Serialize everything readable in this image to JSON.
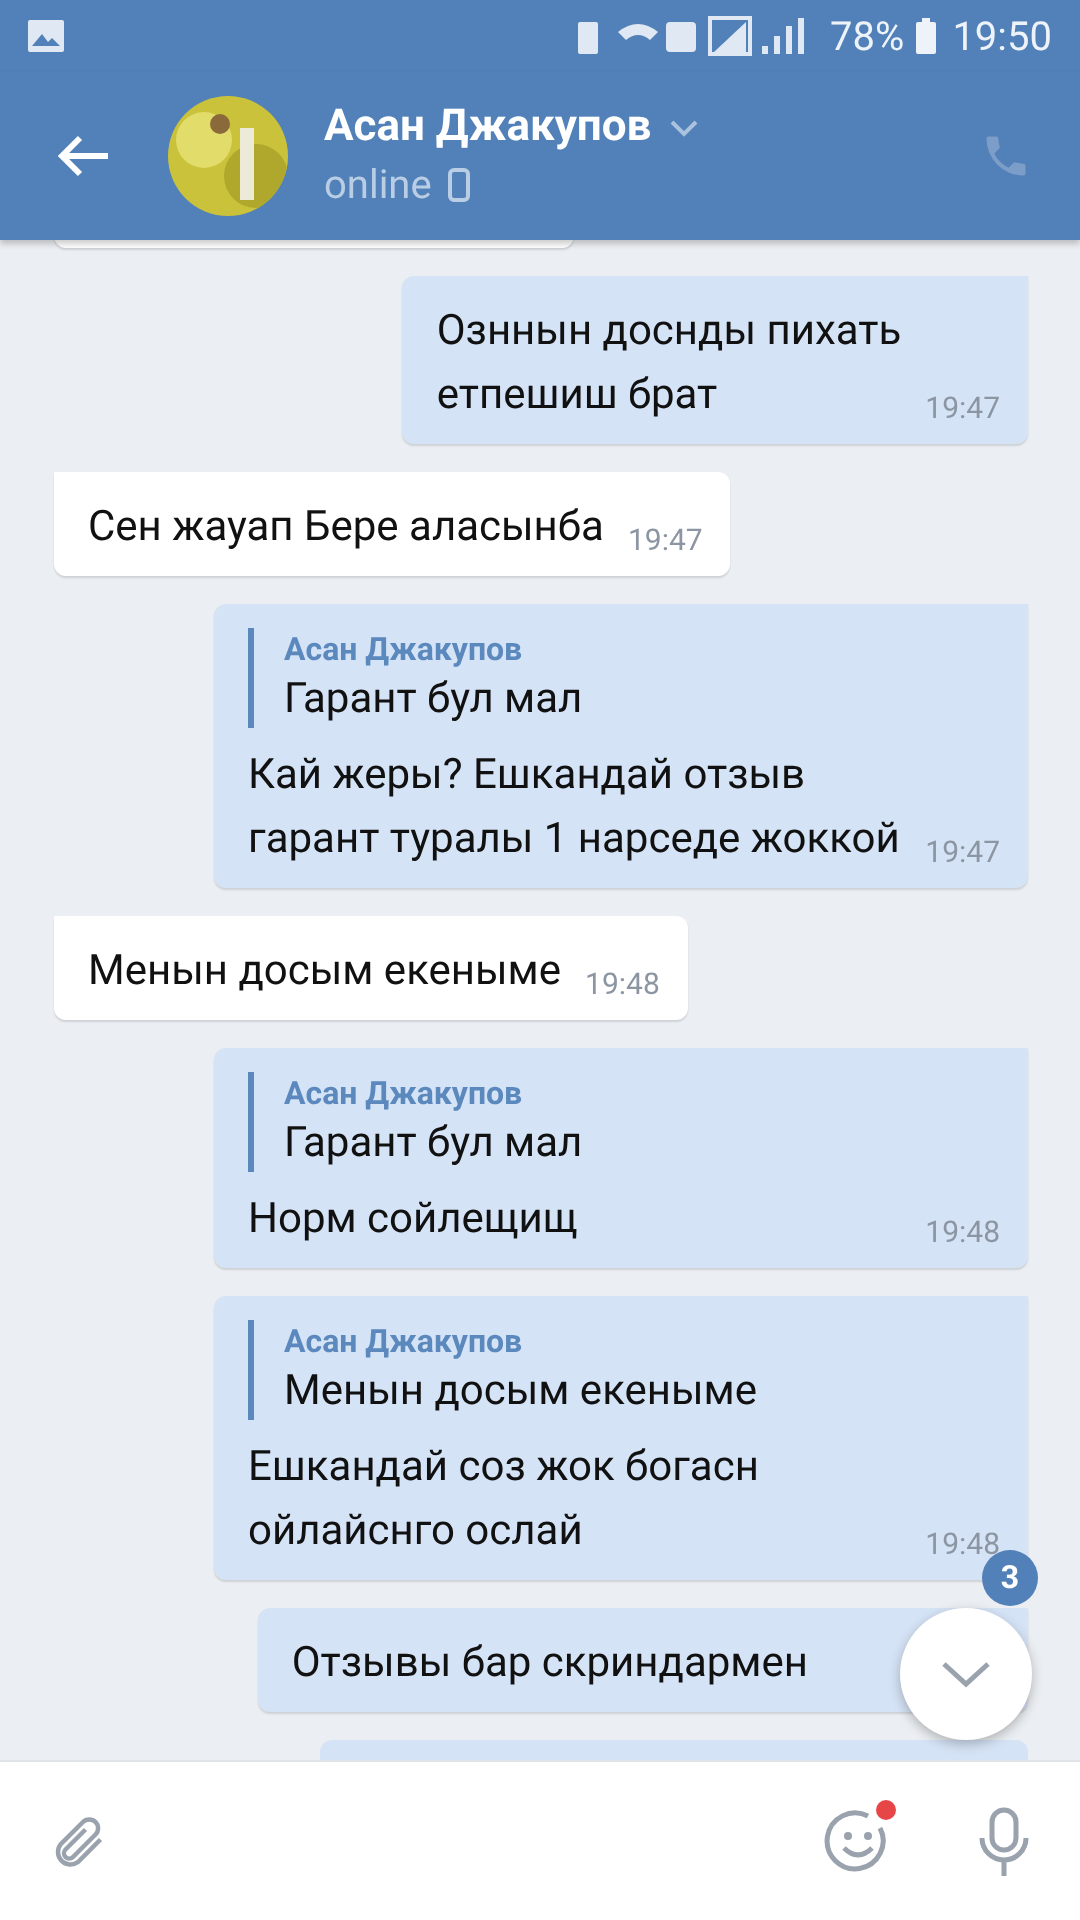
{
  "status_bar": {
    "battery": "78%",
    "time": "19:50"
  },
  "header": {
    "name": "Асан Джакупов",
    "status": "online"
  },
  "messages": [
    {
      "kind": "out",
      "text": "Озннын доснды пихать\nетпешиш брат",
      "time": "19:47"
    },
    {
      "kind": "in",
      "text": "Сен жауап Бере аласынба",
      "time": "19:47"
    },
    {
      "kind": "out",
      "reply": {
        "author": "Асан Джакупов",
        "text": "Гарант бул мал"
      },
      "text": "Кай жеры? Ешкандай отзыв\nгарант туралы 1 нарседе жоккой",
      "time": "19:47"
    },
    {
      "kind": "in",
      "text": "Менын досым екеныме",
      "time": "19:48"
    },
    {
      "kind": "out",
      "reply": {
        "author": "Асан Джакупов",
        "text": "Гарант бул мал"
      },
      "text": "Норм сойлещищ",
      "time": "19:48"
    },
    {
      "kind": "out",
      "reply": {
        "author": "Асан Джакупов",
        "text": "Менын досым екеныме"
      },
      "text": "Ешкандай соз жок богасн\nойлайснго ослай",
      "time": "19:48"
    },
    {
      "kind": "out",
      "text": "Отзывы бар скриндармен"
    }
  ],
  "scroll_button": {
    "badge": "3"
  }
}
